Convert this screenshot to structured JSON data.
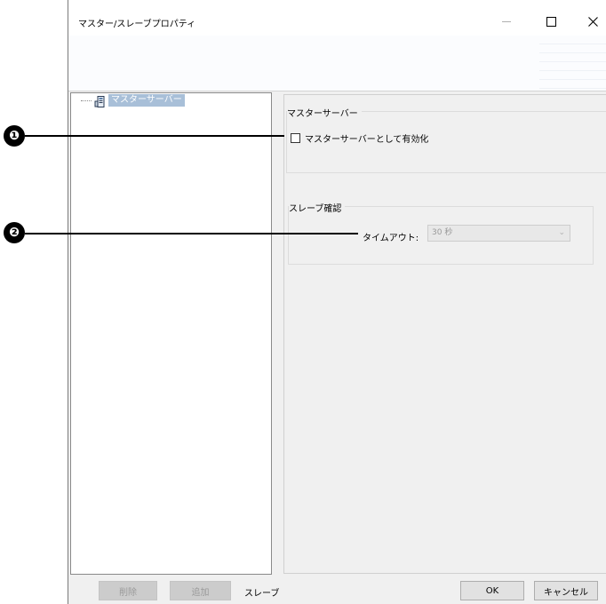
{
  "window": {
    "title": "マスター/スレーブプロパティ"
  },
  "tree": {
    "items": [
      {
        "label": "マスターサーバー",
        "icon": "server-icon",
        "selected": true
      }
    ]
  },
  "master_group": {
    "legend": "マスターサーバー",
    "enable_checkbox_label": "マスターサーバーとして有効化",
    "enable_checked": false
  },
  "slave_group": {
    "legend": "スレーブ確認",
    "timeout_label": "タイムアウト:",
    "timeout_value": "30 秒"
  },
  "bottom": {
    "delete_label": "削除",
    "add_label": "追加",
    "slave_label": "スレーブ",
    "ok_label": "OK",
    "cancel_label": "キャンセル"
  },
  "callouts": [
    "❶",
    "❷"
  ]
}
